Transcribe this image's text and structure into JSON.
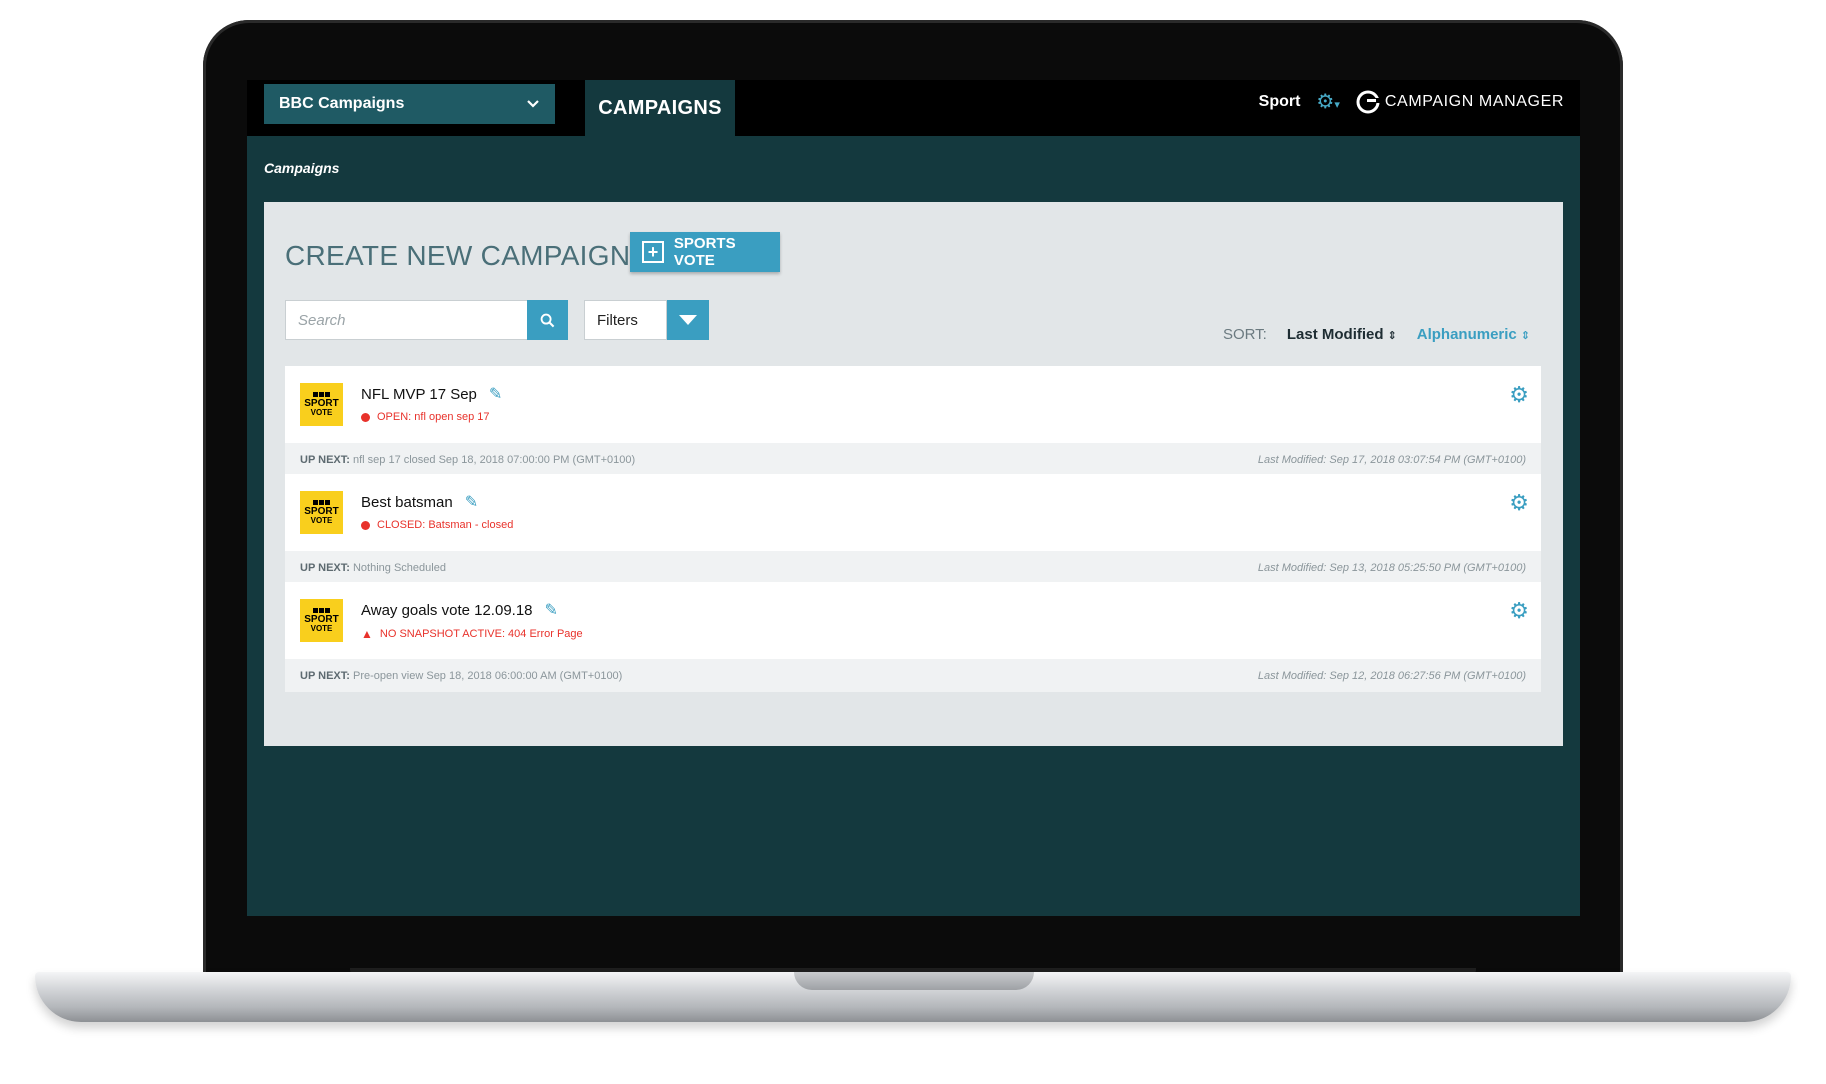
{
  "header": {
    "account_name": "BBC Campaigns",
    "active_tab": "CAMPAIGNS",
    "section": "Sport",
    "brand_name": "CAMPAIGN MANAGER"
  },
  "breadcrumb": "Campaigns",
  "create": {
    "title": "CREATE NEW CAMPAIGN:",
    "button_label": "SPORTS VOTE"
  },
  "search": {
    "placeholder": "Search"
  },
  "filters": {
    "label": "Filters"
  },
  "sort": {
    "label": "SORT:",
    "options": [
      "Last Modified",
      "Alphanumeric"
    ],
    "active": "Alphanumeric"
  },
  "thumbnail": {
    "line1": "SPORT",
    "line2": "VOTE"
  },
  "campaigns": [
    {
      "name": "NFL MVP 17 Sep",
      "status": "OPEN: nfl open sep 17",
      "status_icon": "dot",
      "up_next_label": "UP NEXT:",
      "up_next": "nfl sep 17 closed Sep 18, 2018 07:00:00 PM (GMT+0100)",
      "last_modified": "Last Modified: Sep 17, 2018 03:07:54 PM (GMT+0100)"
    },
    {
      "name": "Best batsman",
      "status": "CLOSED: Batsman - closed",
      "status_icon": "dot",
      "up_next_label": "UP NEXT:",
      "up_next": "Nothing Scheduled",
      "last_modified": "Last Modified: Sep 13, 2018 05:25:50 PM (GMT+0100)"
    },
    {
      "name": "Away goals vote 12.09.18",
      "status": "NO SNAPSHOT ACTIVE: 404 Error Page",
      "status_icon": "warning",
      "up_next_label": "UP NEXT:",
      "up_next": "Pre-open view Sep 18, 2018 06:00:00 AM (GMT+0100)",
      "last_modified": "Last Modified: Sep 12, 2018 06:27:56 PM (GMT+0100)"
    }
  ],
  "colors": {
    "app_background": "#14393e",
    "accent": "#3a9ec1",
    "status_red": "#e8322b",
    "thumbnail_yellow": "#f9cf1d"
  }
}
